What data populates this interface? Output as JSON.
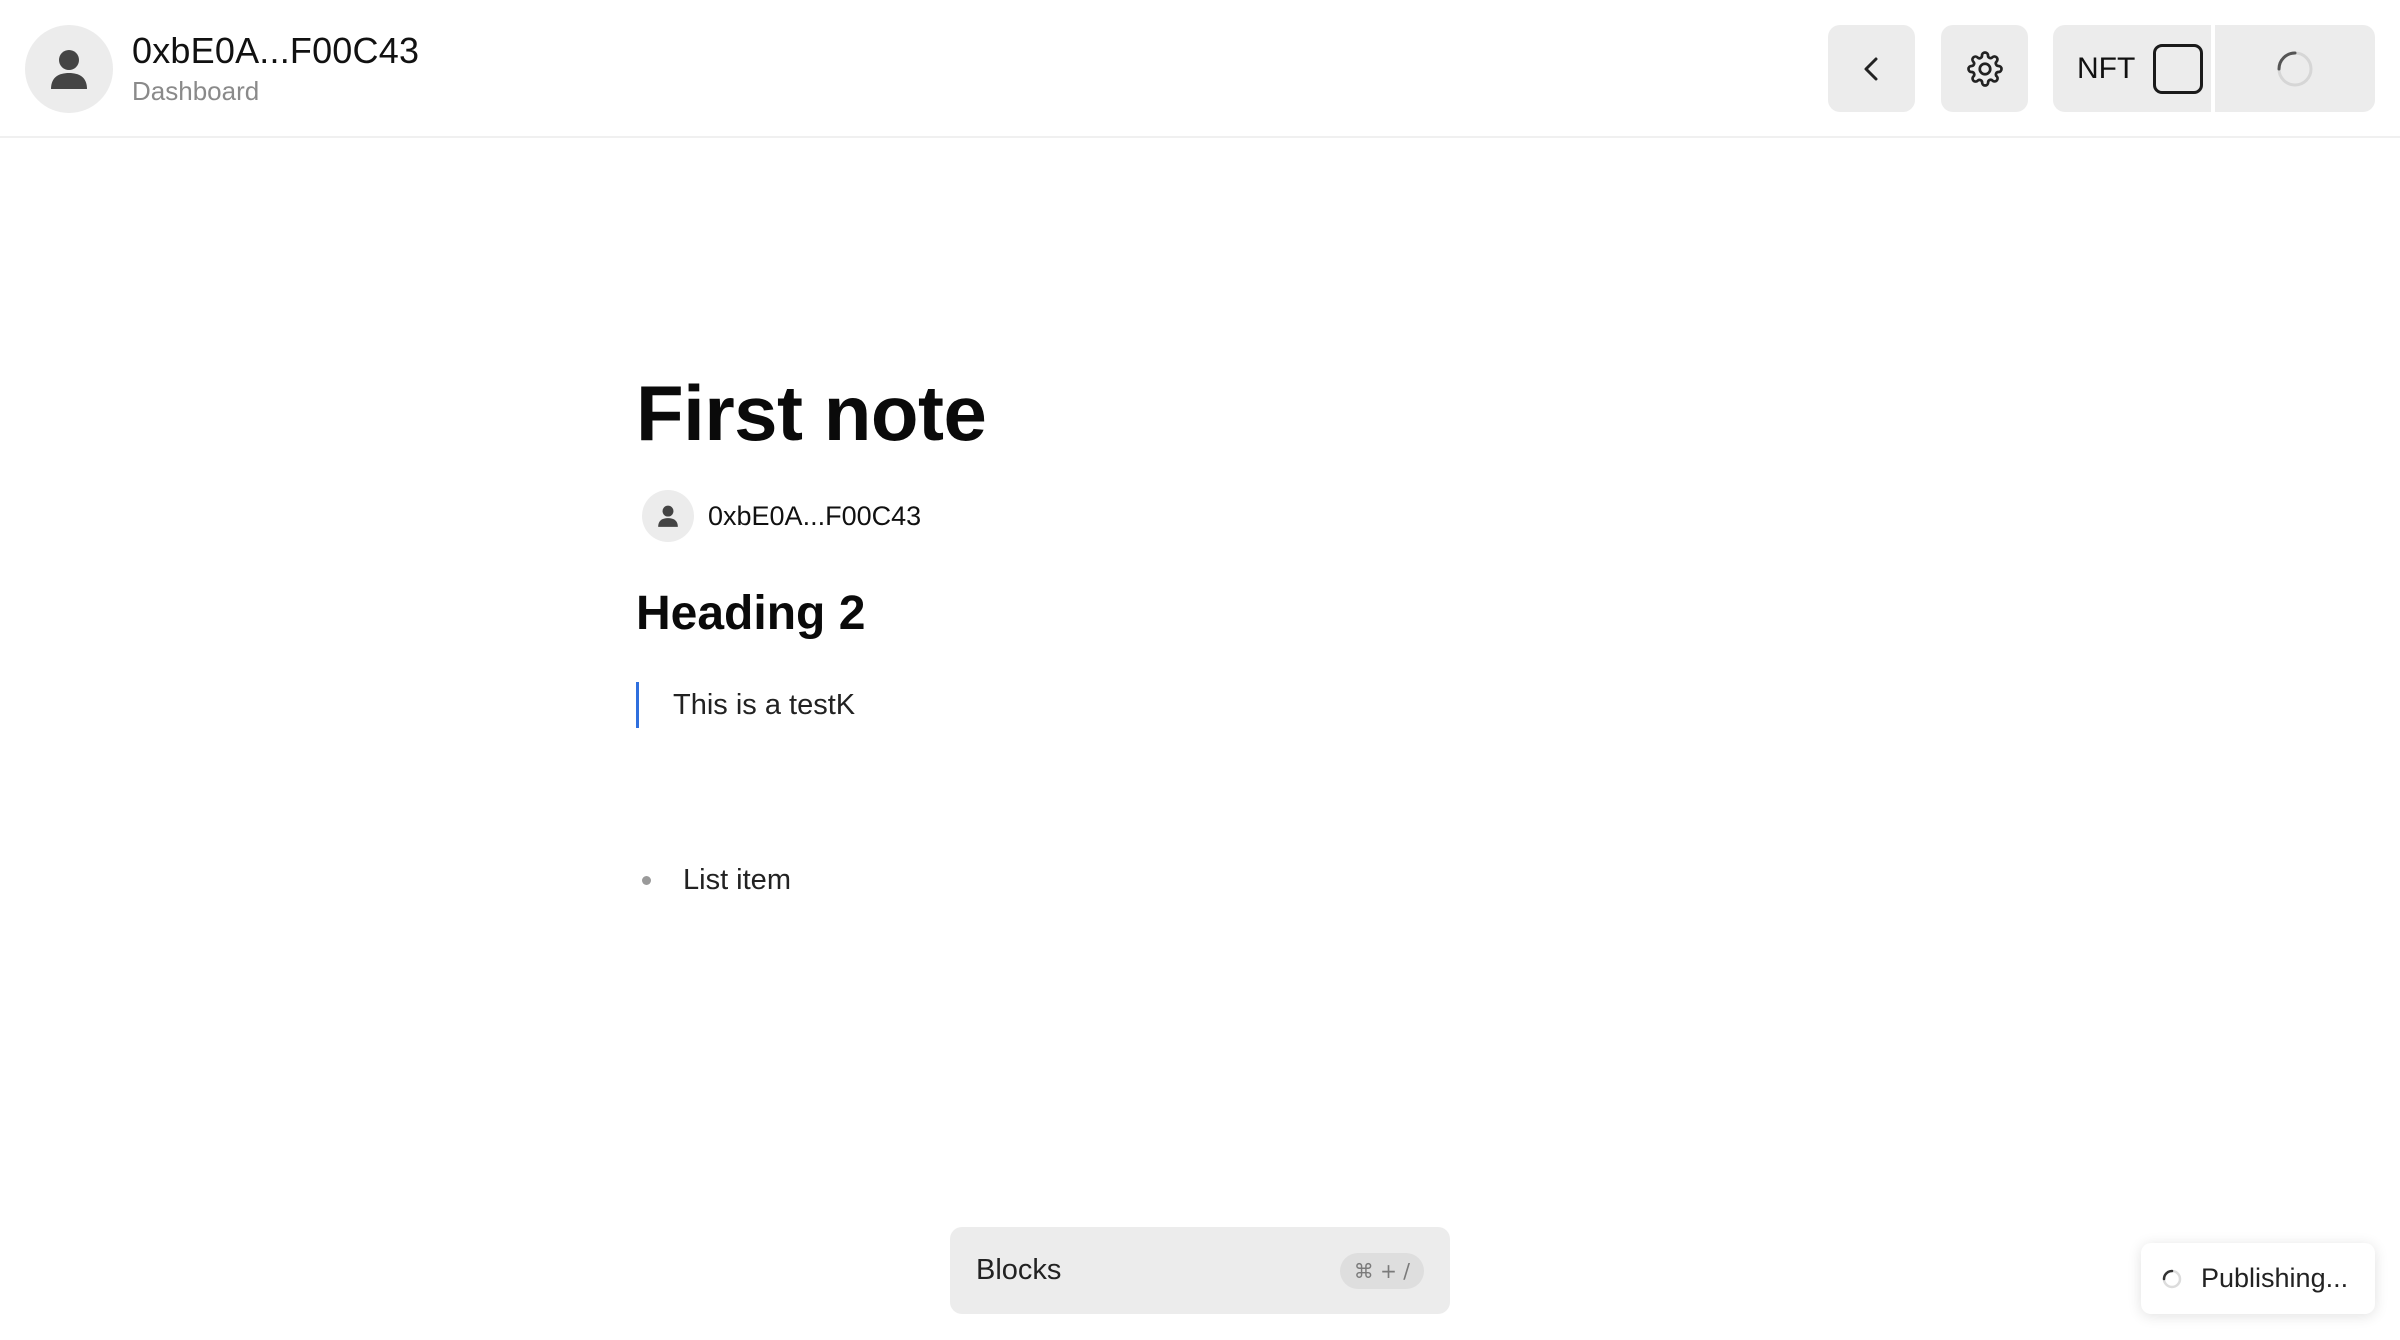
{
  "header": {
    "account": "0xbE0A...F00C43",
    "subtitle": "Dashboard",
    "nft_label": "NFT"
  },
  "document": {
    "title": "First note",
    "author": "0xbE0A...F00C43",
    "heading": "Heading 2",
    "quote": "This is a testK",
    "list_items": [
      "List item"
    ]
  },
  "blocks": {
    "label": "Blocks",
    "shortcut": "⌘ + /"
  },
  "toast": {
    "text": "Publishing..."
  },
  "colors": {
    "accent": "#2f6fde",
    "button_bg": "#ececec",
    "muted_text": "#8a8a8a"
  },
  "icons": {
    "avatar": "user-icon",
    "back": "chevron-left-icon",
    "settings": "gear-icon",
    "nft": "checkbox-icon",
    "loading": "spinner-icon"
  }
}
